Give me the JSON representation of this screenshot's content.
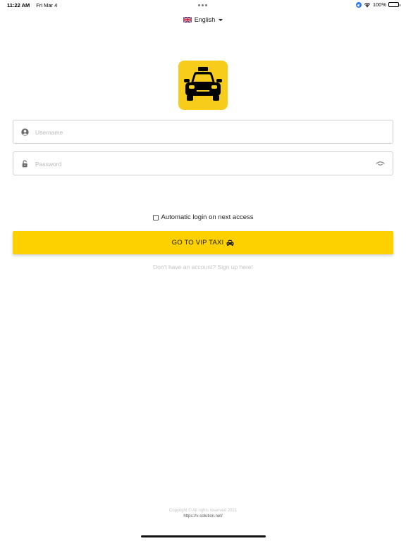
{
  "status_bar": {
    "time": "11:22 AM",
    "date": "Fri Mar 4",
    "battery": "100%"
  },
  "language": {
    "selected": "English",
    "flag_icon": "uk-flag-icon"
  },
  "logo": {
    "icon": "taxi-icon",
    "background_color": "#f7cc1a"
  },
  "login_form": {
    "username_placeholder": "Username",
    "password_placeholder": "Password",
    "username_icon": "user-circle-icon",
    "password_icon": "unlock-icon",
    "toggle_icon": "eye-icon",
    "remember_label": "Automatic login on next access",
    "remember_checked": false
  },
  "submit": {
    "label": "GO TO VIP TAXI",
    "icon": "car-icon",
    "color": "#fdd100"
  },
  "signup_link": "Don't have an account? Sign up here!",
  "footer": {
    "copyright": "Copyright © All rights reserved 2021",
    "website": "https://v-solution.net/"
  }
}
